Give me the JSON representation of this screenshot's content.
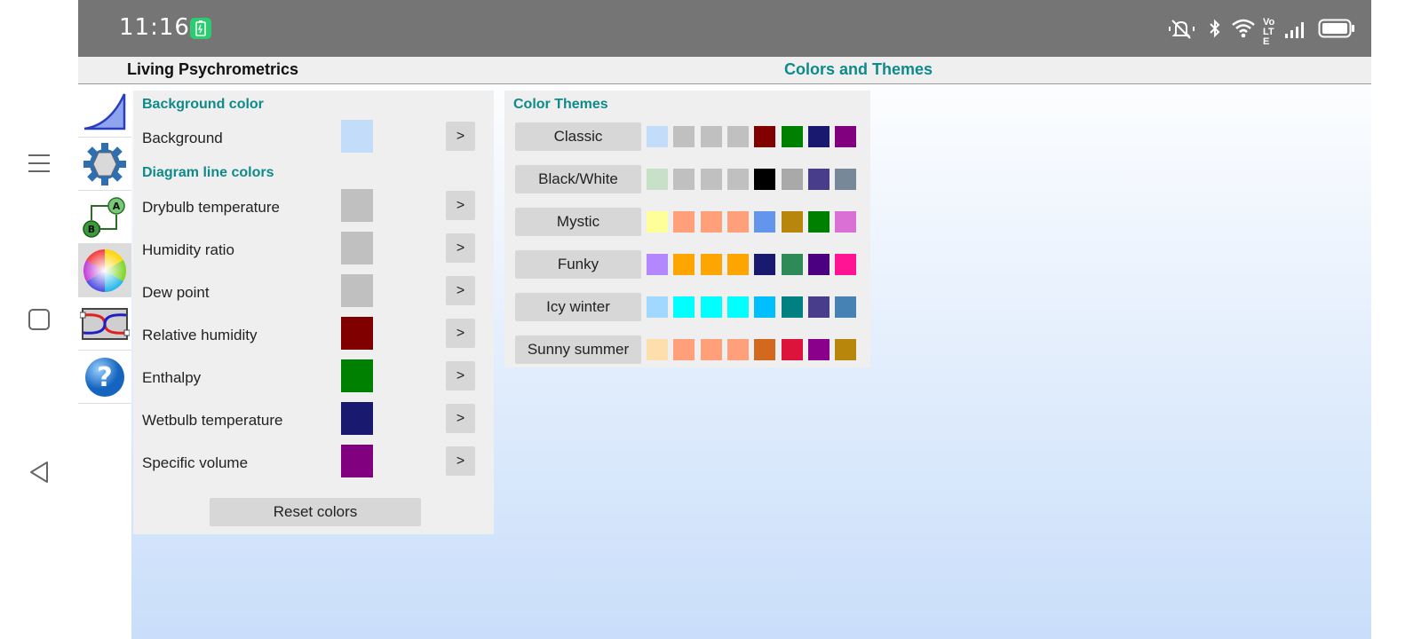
{
  "status_bar": {
    "time": "11:16",
    "icons": [
      "battery-saver-icon",
      "mute-icon",
      "bluetooth-icon",
      "wifi-icon",
      "volte-icon",
      "signal-icon",
      "battery-icon"
    ],
    "volte_text": "Vo LTE"
  },
  "nav": {
    "icons": [
      "menu-icon",
      "home-square-icon",
      "back-triangle-icon"
    ]
  },
  "app": {
    "name": "Living Psychrometrics",
    "page_title": "Colors and Themes"
  },
  "toolbar": {
    "tools": [
      {
        "icon": "chart-icon"
      },
      {
        "icon": "settings-gear-icon"
      },
      {
        "icon": "process-ab-icon"
      },
      {
        "icon": "color-wheel-icon",
        "active": true
      },
      {
        "icon": "heat-exchanger-icon"
      },
      {
        "icon": "help-icon"
      }
    ]
  },
  "colors_panel": {
    "background_heading": "Background color",
    "background": {
      "label": "Background",
      "color": "#c2dcfa",
      "button": ">"
    },
    "lines_heading": "Diagram line colors",
    "lines": [
      {
        "label": "Drybulb temperature",
        "color": "#c0c0c0",
        "button": ">"
      },
      {
        "label": "Humidity ratio",
        "color": "#c0c0c0",
        "button": ">"
      },
      {
        "label": "Dew point",
        "color": "#c0c0c0",
        "button": ">"
      },
      {
        "label": "Relative humidity",
        "color": "#800000",
        "button": ">"
      },
      {
        "label": "Enthalpy",
        "color": "#008000",
        "button": ">"
      },
      {
        "label": "Wetbulb temperature",
        "color": "#191970",
        "button": ">"
      },
      {
        "label": "Specific volume",
        "color": "#800080",
        "button": ">"
      }
    ],
    "reset_label": "Reset colors"
  },
  "themes_panel": {
    "heading": "Color Themes",
    "themes": [
      {
        "name": "Classic",
        "colors": [
          "#c2dcfa",
          "#c0c0c0",
          "#c0c0c0",
          "#c0c0c0",
          "#800000",
          "#008000",
          "#191970",
          "#800080"
        ]
      },
      {
        "name": "Black/White",
        "colors": [
          "#c8e0c8",
          "#c0c0c0",
          "#c0c0c0",
          "#c0c0c0",
          "#000000",
          "#a9a9a9",
          "#483d8b",
          "#778899"
        ]
      },
      {
        "name": "Mystic",
        "colors": [
          "#ffff99",
          "#ffa07a",
          "#ffa07a",
          "#ffa07a",
          "#6495ed",
          "#b8860b",
          "#008000",
          "#da70d6"
        ]
      },
      {
        "name": "Funky",
        "colors": [
          "#b388ff",
          "#ffa500",
          "#ffa500",
          "#ffa500",
          "#191970",
          "#2e8b57",
          "#4b0082",
          "#ff1493"
        ]
      },
      {
        "name": "Icy winter",
        "colors": [
          "#a0d8ff",
          "#00ffff",
          "#00ffff",
          "#00ffff",
          "#00bfff",
          "#008080",
          "#483d8b",
          "#4682b4"
        ]
      },
      {
        "name": "Sunny summer",
        "colors": [
          "#ffdead",
          "#ffa07a",
          "#ffa07a",
          "#ffa07a",
          "#d2691e",
          "#dc143c",
          "#8b008b",
          "#b8860b"
        ]
      }
    ]
  }
}
